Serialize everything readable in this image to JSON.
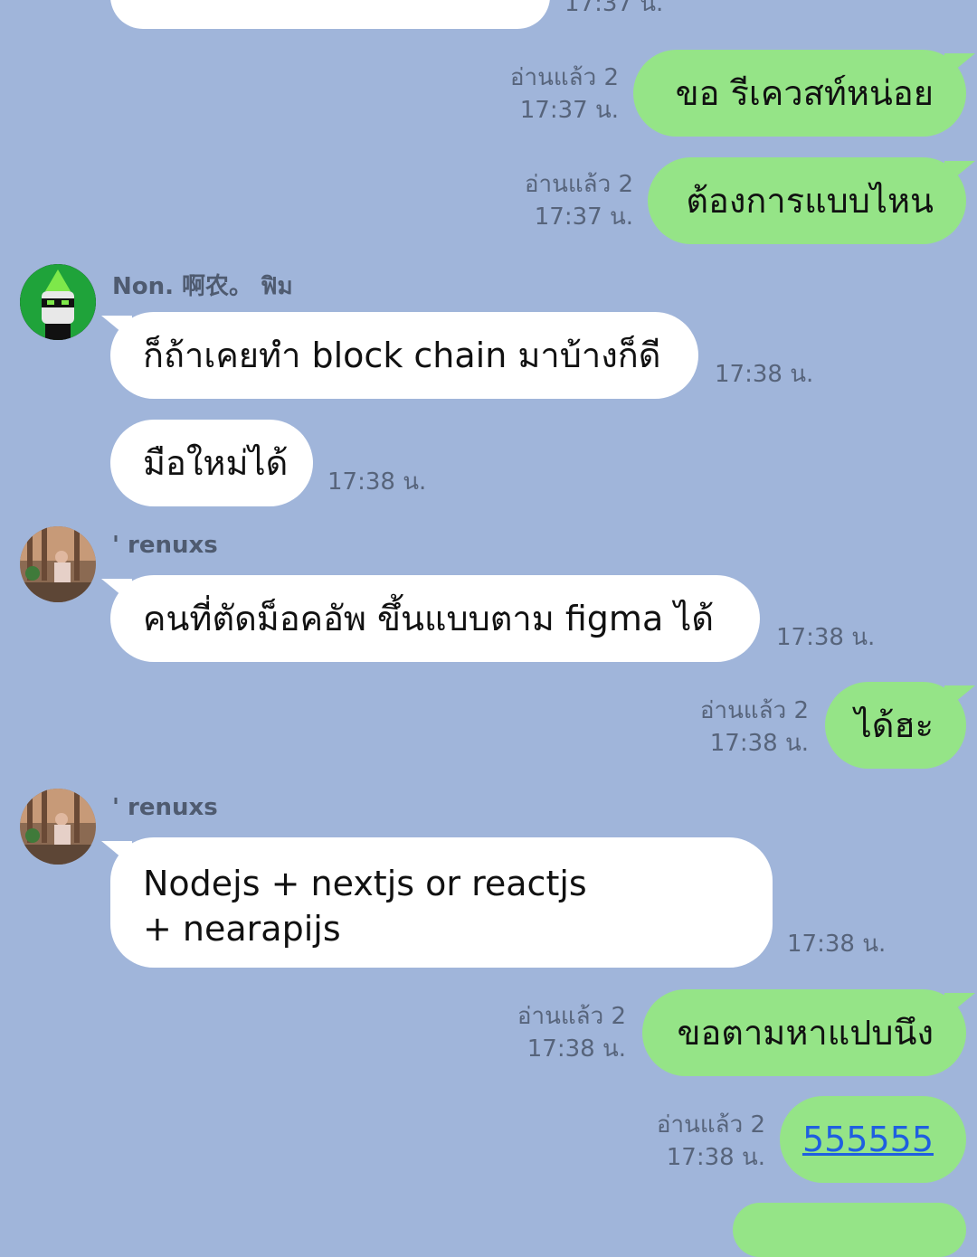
{
  "messages": [
    {
      "id": "m0",
      "type": "out",
      "text": "",
      "read": "",
      "time": "17:37 น."
    },
    {
      "id": "m1",
      "type": "out",
      "text": "ขอ รีเควสท์หน่อย",
      "read": "อ่านแล้ว 2",
      "time": "17:37 น."
    },
    {
      "id": "m2",
      "type": "out",
      "text": "ต้องการแบบไหน",
      "read": "อ่านแล้ว 2",
      "time": "17:37 น."
    },
    {
      "id": "m3",
      "type": "in",
      "sender": "Non. 啊农。 ฟิม",
      "text": "ก็ถ้าเคยทำ block chain มาบ้างก็ดี",
      "time": "17:38 น."
    },
    {
      "id": "m4",
      "type": "in",
      "text": "มือใหม่ได้",
      "time": "17:38 น."
    },
    {
      "id": "m5",
      "type": "in",
      "sender": "' renuxs",
      "text": "คนที่ตัดม็อคอัพ ขึ้นแบบตาม figma ได้",
      "time": "17:38 น."
    },
    {
      "id": "m6",
      "type": "out",
      "text": "ได้ฮะ",
      "read": "อ่านแล้ว 2",
      "time": "17:38 น."
    },
    {
      "id": "m7",
      "type": "in",
      "sender": "' renuxs",
      "text": "Nodejs + nextjs or reactjs + nearapijs",
      "time": "17:38 น."
    },
    {
      "id": "m8",
      "type": "out",
      "text": "ขอตามหาแปบนึง",
      "read": "อ่านแล้ว 2",
      "time": "17:38 น."
    },
    {
      "id": "m9",
      "type": "out",
      "text": "555555",
      "read": "อ่านแล้ว 2",
      "time": "17:38 น.",
      "link": true
    }
  ],
  "icons": {
    "avatar1": "avatar-green-hood-icon",
    "avatar2": "avatar-photo-icon"
  },
  "colors": {
    "background": "#a0b5da",
    "outgoing": "#95e487",
    "incoming": "#ffffff",
    "link": "#1f5fe0"
  }
}
